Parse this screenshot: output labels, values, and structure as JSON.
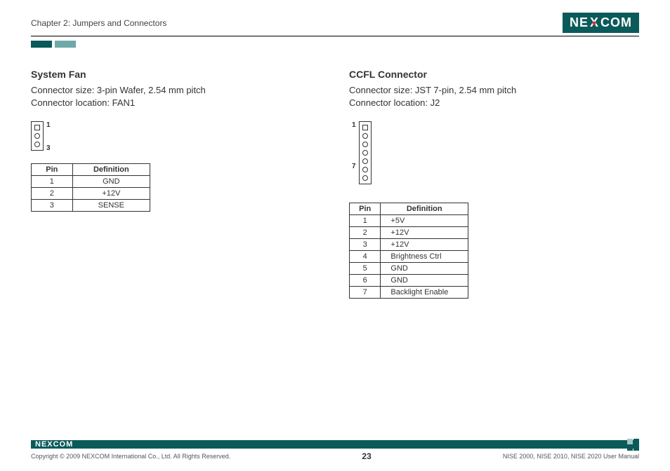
{
  "header": {
    "chapter": "Chapter 2: Jumpers and Connectors",
    "logo_text_left": "NE",
    "logo_text_x": "X",
    "logo_text_right": "COM"
  },
  "left": {
    "title": "System Fan",
    "size": "Connector size: 3-pin Wafer, 2.54 mm pitch",
    "location": "Connector location: FAN1",
    "pin_label_top": "1",
    "pin_label_bottom": "3",
    "table_headers": {
      "pin": "Pin",
      "def": "Definition"
    },
    "rows": [
      {
        "pin": "1",
        "def": "GND"
      },
      {
        "pin": "2",
        "def": "+12V"
      },
      {
        "pin": "3",
        "def": "SENSE"
      }
    ]
  },
  "right": {
    "title": "CCFL Connector",
    "size": "Connector size: JST 7-pin, 2.54 mm pitch",
    "location": "Connector location: J2",
    "pin_label_top": "1",
    "pin_label_bottom": "7",
    "table_headers": {
      "pin": "Pin",
      "def": "Definition"
    },
    "rows": [
      {
        "pin": "1",
        "def": "+5V"
      },
      {
        "pin": "2",
        "def": "+12V"
      },
      {
        "pin": "3",
        "def": "+12V"
      },
      {
        "pin": "4",
        "def": "Brightness Ctrl"
      },
      {
        "pin": "5",
        "def": "GND"
      },
      {
        "pin": "6",
        "def": "GND"
      },
      {
        "pin": "7",
        "def": "Backlight Enable"
      }
    ]
  },
  "footer": {
    "logo": "NEXCOM",
    "copyright": "Copyright © 2009 NEXCOM International Co., Ltd. All Rights Reserved.",
    "page": "23",
    "manual": "NISE 2000, NISE 2010, NISE 2020 User Manual"
  }
}
